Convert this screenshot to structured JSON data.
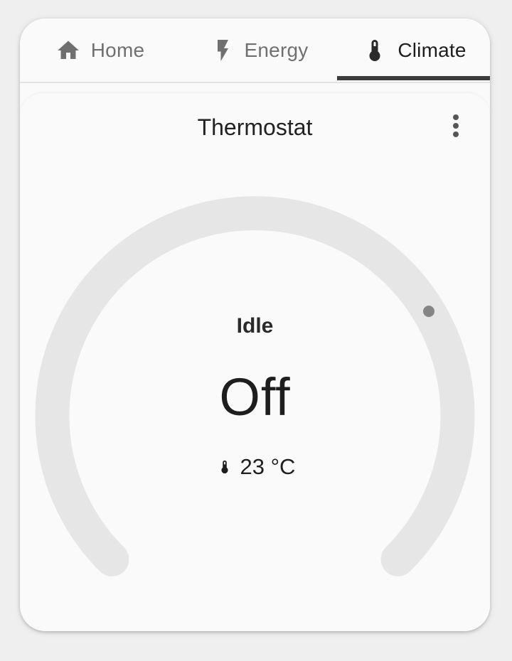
{
  "tabs": [
    {
      "label": "Home",
      "icon": "home-icon",
      "active": false
    },
    {
      "label": "Energy",
      "icon": "lightning-bolt-icon",
      "active": false
    },
    {
      "label": "Climate",
      "icon": "thermometer-icon",
      "active": true
    }
  ],
  "thermostat": {
    "title": "Thermostat",
    "status": "Idle",
    "mode_value": "Off",
    "current_temperature": "23 °C",
    "menu_icon": "more-vertical-icon"
  },
  "colors": {
    "background": "#efefef",
    "card": "#fafafa",
    "track": "#e6e6e6",
    "handle": "#858585",
    "active_tab_indicator": "#3c3c3c",
    "inactive_tab_text": "#707070",
    "text": "#1e1e1e"
  }
}
